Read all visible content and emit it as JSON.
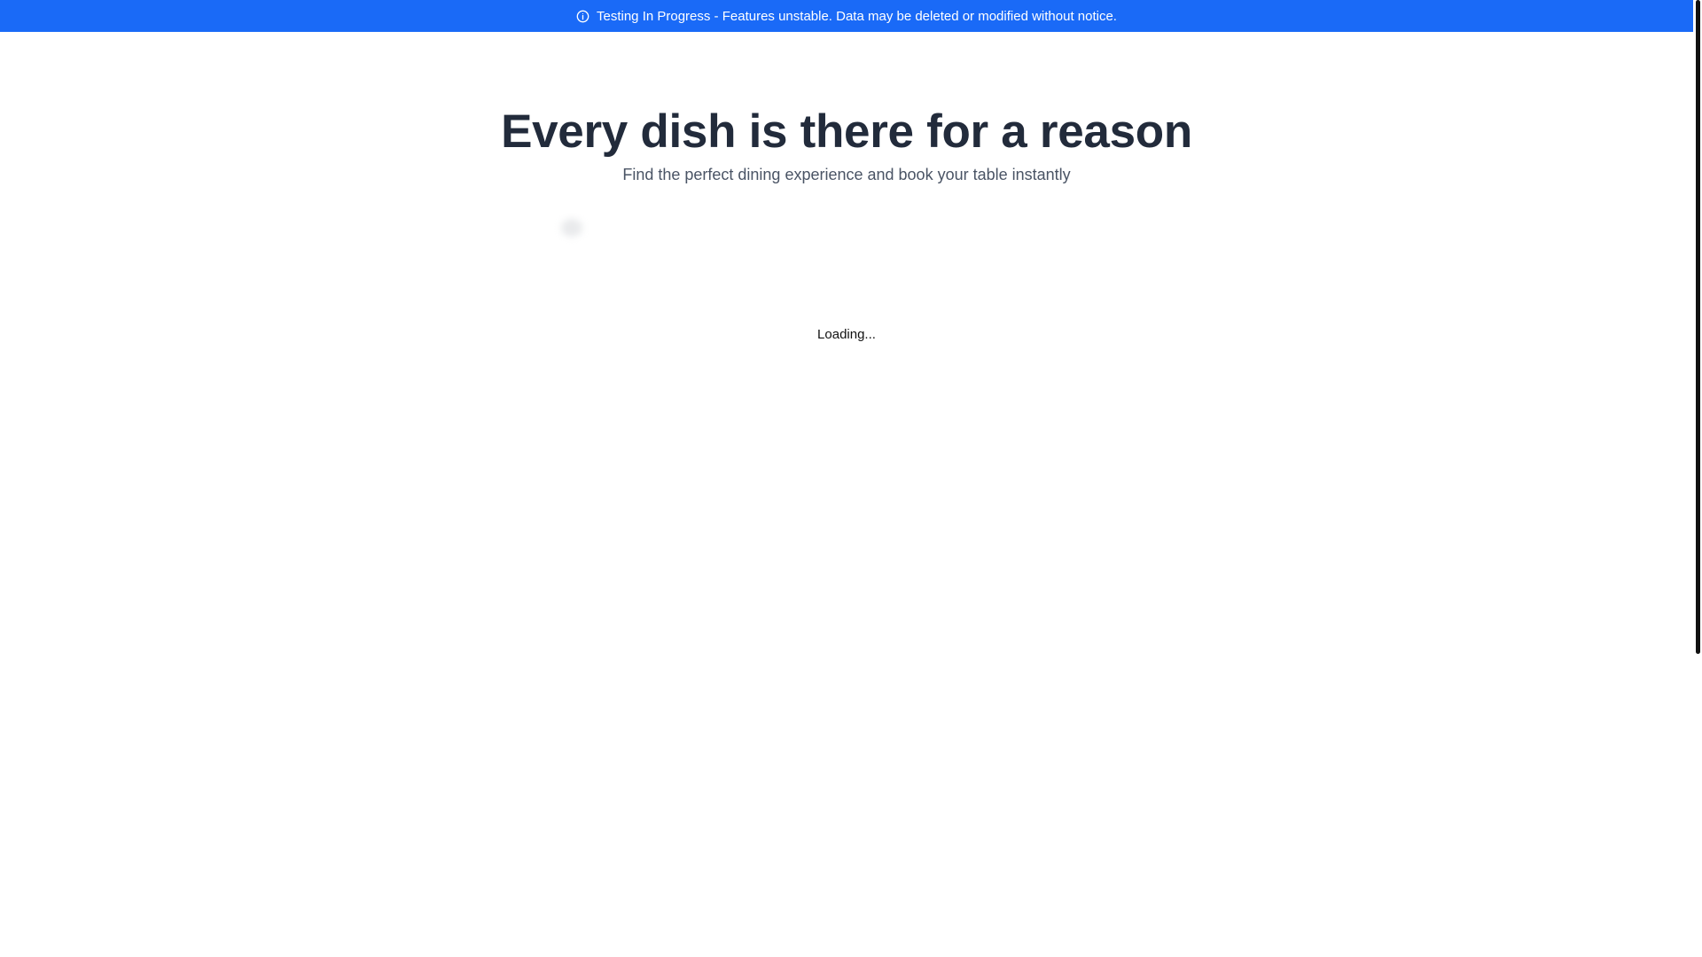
{
  "banner": {
    "icon": "info-icon",
    "text": "Testing In Progress - Features unstable. Data may be deleted or modified without notice.",
    "background_color": "#1a6af7",
    "text_color": "#ffffff"
  },
  "hero": {
    "title": "Every dish is there for a reason",
    "subtitle": "Find the perfect dining experience and book your table instantly"
  },
  "content": {
    "loading_text": "Loading..."
  },
  "colors": {
    "title": "#222b3b",
    "subtitle": "#4a5465",
    "accent": "#1a6af7"
  }
}
